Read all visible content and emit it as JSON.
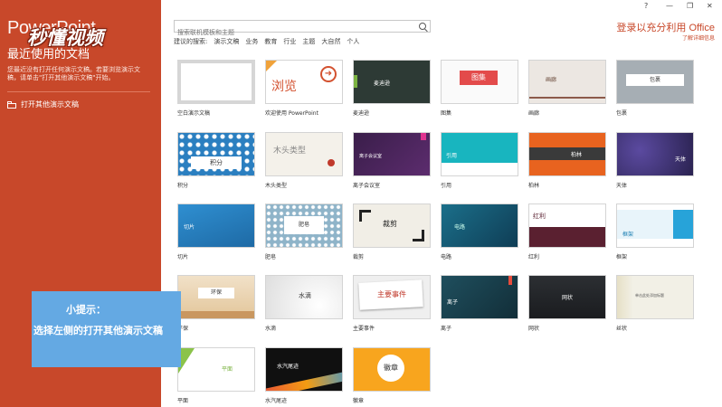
{
  "sidebar": {
    "app_name": "PowerPoint",
    "recent_title": "最近使用的文档",
    "recent_desc": "您最近没有打开任何演示文稿。若要浏览演示文稿，请单击\"打开其他演示文稿\"开始。",
    "open_other": "打开其他演示文稿",
    "watermark": "秒懂视频"
  },
  "search": {
    "placeholder": "搜索联机模板和主题"
  },
  "suggested": {
    "label": "建议的搜索:",
    "items": [
      "演示文稿",
      "业务",
      "教育",
      "行业",
      "主题",
      "大自然",
      "个人"
    ]
  },
  "window": {
    "help": "?",
    "minimize": "—",
    "restore": "❐",
    "close": "✕"
  },
  "account": {
    "signin": "登录以充分利用 Office",
    "learn_more": "了解详细信息"
  },
  "templates": [
    {
      "name": "空白演示文稿",
      "label": ""
    },
    {
      "name": "欢迎使用 PowerPoint",
      "label": "浏览"
    },
    {
      "name": "麦迪逊",
      "label": "麦迪逊"
    },
    {
      "name": "图集",
      "label": "图集"
    },
    {
      "name": "画廊",
      "label": "画廊"
    },
    {
      "name": "包裹",
      "label": "包裹"
    },
    {
      "name": "积分",
      "label": "积分"
    },
    {
      "name": "木头类型",
      "label": "木头类型"
    },
    {
      "name": "离子会议室",
      "label": "离子会议室"
    },
    {
      "name": "引用",
      "label": "引用"
    },
    {
      "name": "柏林",
      "label": "柏林"
    },
    {
      "name": "天体",
      "label": "天体"
    },
    {
      "name": "切片",
      "label": "切片"
    },
    {
      "name": "肥皂",
      "label": "肥皂"
    },
    {
      "name": "裁剪",
      "label": "裁剪"
    },
    {
      "name": "电路",
      "label": "电路"
    },
    {
      "name": "红利",
      "label": "红利"
    },
    {
      "name": "框架",
      "label": "框架"
    },
    {
      "name": "环保",
      "label": "环保"
    },
    {
      "name": "水滴",
      "label": "水滴"
    },
    {
      "name": "主要事件",
      "label": "主要事件"
    },
    {
      "name": "离子",
      "label": "离子"
    },
    {
      "name": "网状",
      "label": "网状"
    },
    {
      "name": "丝状",
      "label": "单击此处添加标题"
    },
    {
      "name": "平面",
      "label": "平面"
    },
    {
      "name": "水汽尾迹",
      "label": "水汽尾迹"
    },
    {
      "name": "徽章",
      "label": "徽章"
    }
  ],
  "hint": {
    "title": "小提示：",
    "text": "选择左侧的打开其他演示文稿"
  },
  "colors": {
    "accent": "#c8482a",
    "hint_bg": "#64a9e3"
  }
}
